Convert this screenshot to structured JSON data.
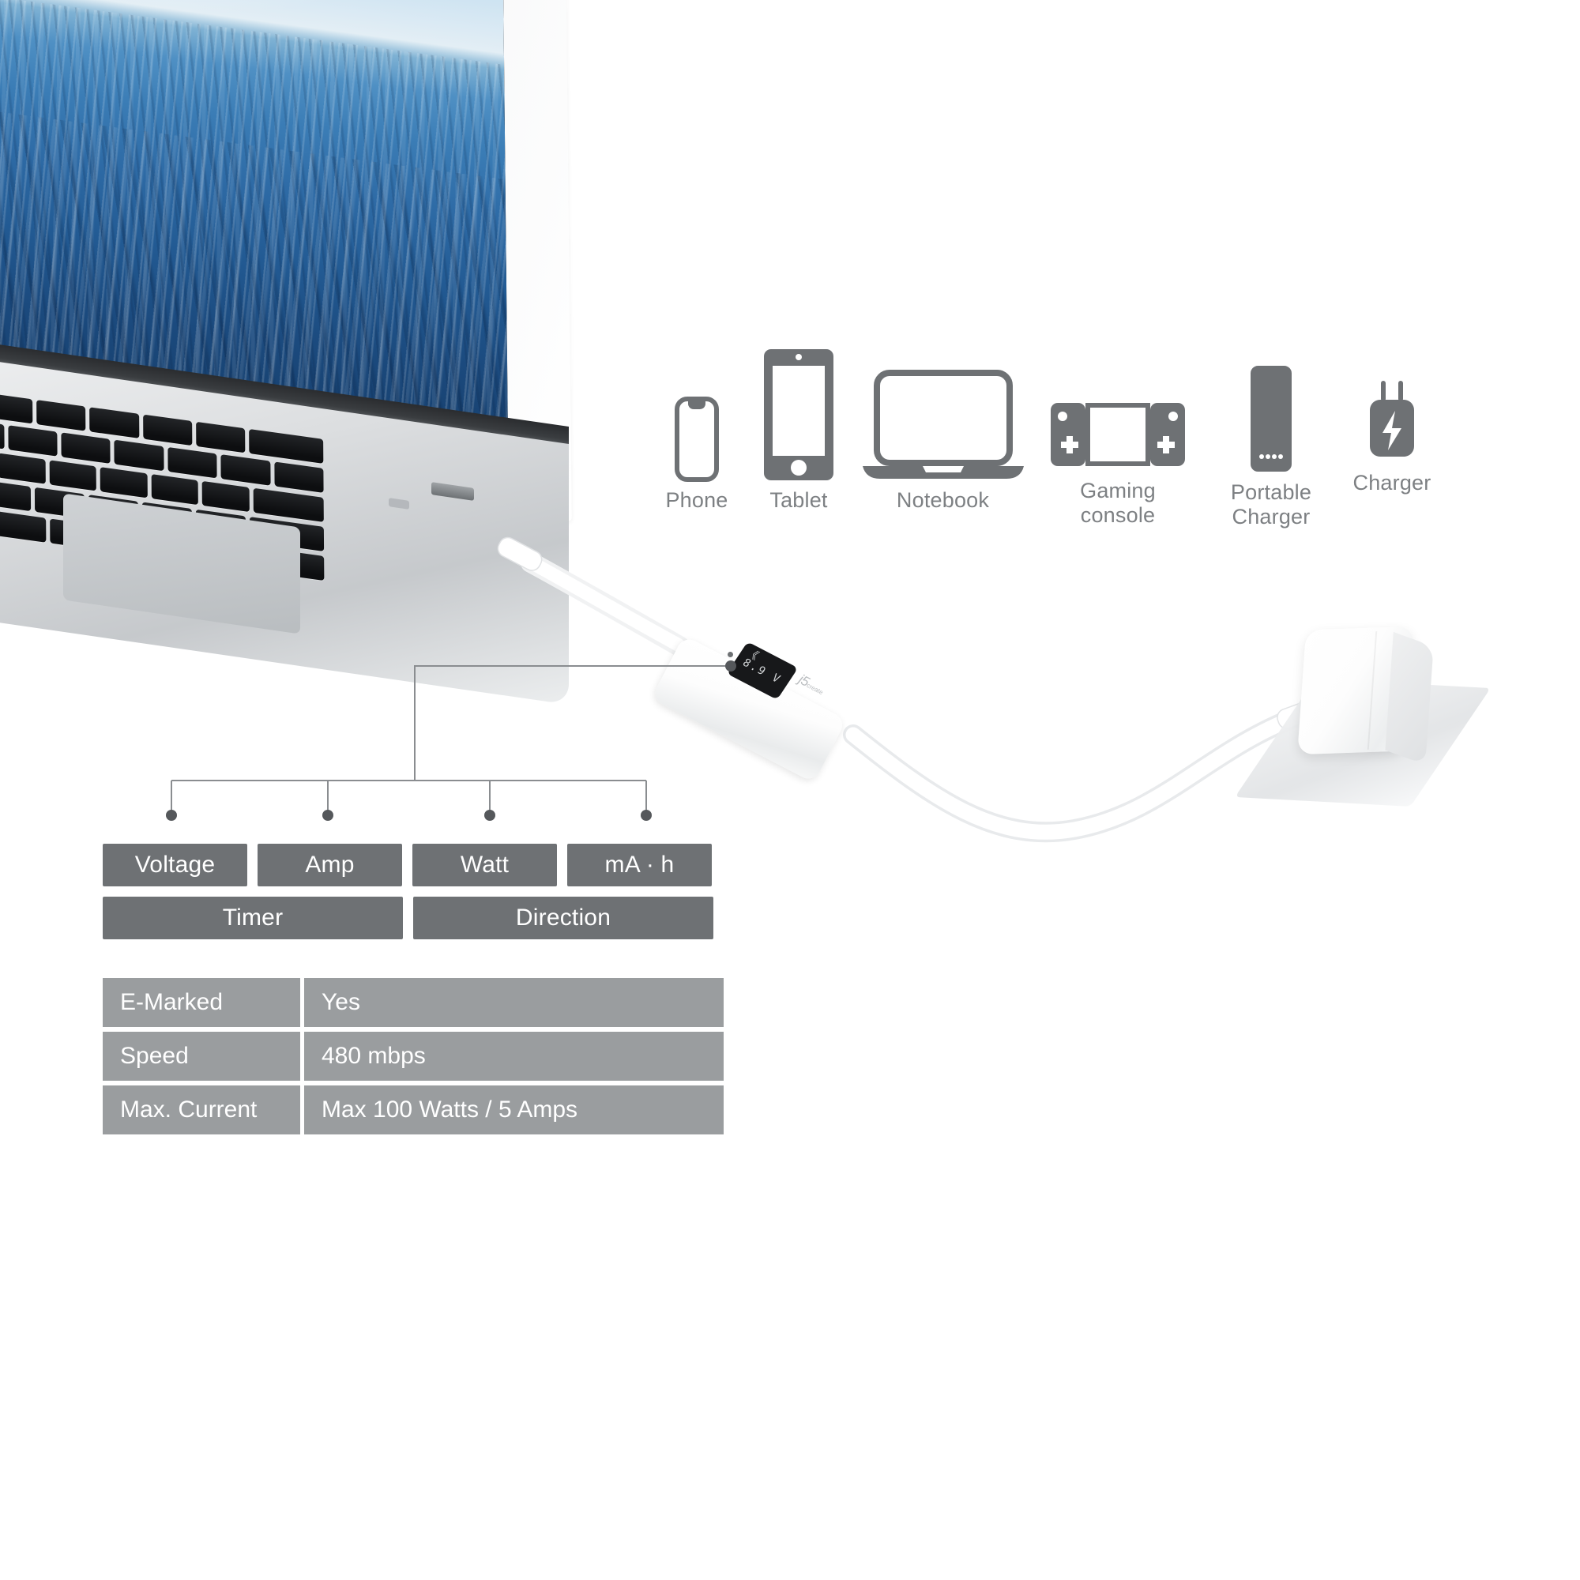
{
  "scene": {
    "laptop": {
      "name": "notebook-computer",
      "wallpaper": "ocean-horizon-wallpaper"
    },
    "meter": {
      "display_value": "8.9 V",
      "display_arrow": "《",
      "brand": "j5",
      "brand_suffix": "create",
      "indicator": "status-led"
    },
    "adapter": {
      "name": "power-adapter"
    }
  },
  "devices": {
    "items": [
      {
        "label": "Phone",
        "icon": "phone-icon"
      },
      {
        "label": "Tablet",
        "icon": "tablet-icon"
      },
      {
        "label": "Notebook",
        "icon": "notebook-icon"
      },
      {
        "label": "Gaming\nconsole",
        "icon": "gaming-console-icon"
      },
      {
        "label": "Portable\nCharger",
        "icon": "portable-charger-icon"
      },
      {
        "label": "Charger",
        "icon": "wall-charger-icon"
      }
    ]
  },
  "tags": {
    "row1": [
      "Voltage",
      "Amp",
      "Watt",
      "mA · h"
    ],
    "row2": [
      "Timer",
      "Direction"
    ]
  },
  "spec_table": {
    "rows": [
      {
        "key": "E-Marked",
        "value": "Yes"
      },
      {
        "key": "Speed",
        "value": "480 mbps"
      },
      {
        "key": "Max. Current",
        "value": "Max 100 Watts / 5 Amps"
      }
    ]
  },
  "colors": {
    "tag_gray": "#6e7174",
    "table_gray": "#9a9d9f",
    "icon_gray": "#6e7174",
    "label_gray": "#7d8083",
    "leader_line": "#8a8d90"
  }
}
